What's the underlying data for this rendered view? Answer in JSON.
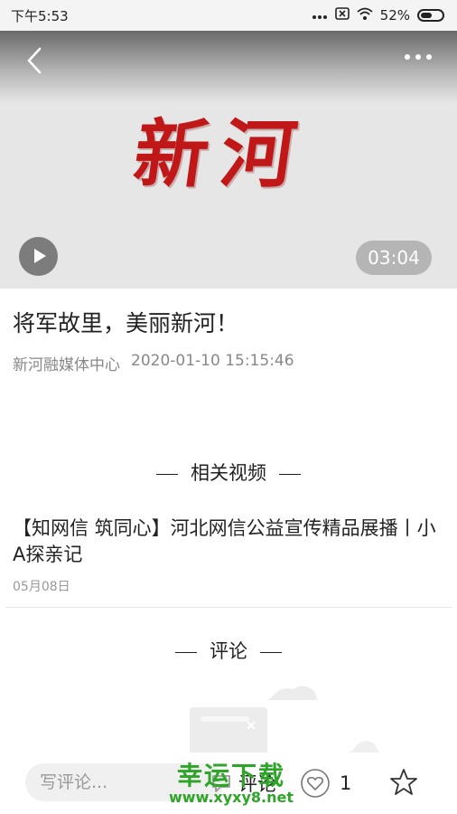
{
  "status": {
    "time": "下午5:53",
    "battery": "52%"
  },
  "video": {
    "logo_text": "新河",
    "duration": "03:04"
  },
  "article": {
    "title": "将军故里，美丽新河！",
    "source": "新河融媒体中心",
    "datetime": "2020-01-10 15:15:46"
  },
  "related": {
    "heading": "相关视频",
    "items": [
      {
        "title": "【知网信 筑同心】河北网信公益宣传精品展播丨小A探亲记",
        "date": "05月08日"
      }
    ]
  },
  "comments": {
    "heading": "评论"
  },
  "bottombar": {
    "input_placeholder": "写评论...",
    "comment_label": "评论",
    "like_count": "1"
  },
  "watermark": {
    "cn": "幸运下载",
    "en": "www.xyxy8.net"
  }
}
